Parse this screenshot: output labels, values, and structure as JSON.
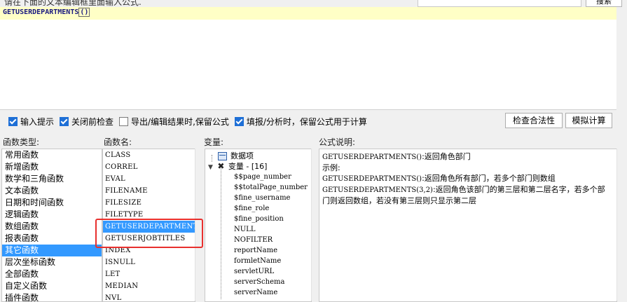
{
  "top": {
    "hint": "请在下面的文本编辑框里面输入公式.",
    "search_button": "搜索"
  },
  "editor": {
    "formula_name": "GETUSERDEPARTMENTS",
    "open_paren": "(",
    "close_paren": ")"
  },
  "options": {
    "input_hint": "输入提示",
    "check_before_close": "关闭前检查",
    "export_keep_formula": "导出/编辑结果时,保留公式",
    "fill_keep_formula": "填报/分析时，保留公式用于计算",
    "check_validity": "检查合法性",
    "simulate": "模拟计算"
  },
  "labels": {
    "func_type": "函数类型:",
    "func_name": "函数名:",
    "variable": "变量:",
    "formula_desc": "公式说明:"
  },
  "func_types": [
    {
      "label": "常用函数",
      "selected": false
    },
    {
      "label": "新增函数",
      "selected": false
    },
    {
      "label": "数学和三角函数",
      "selected": false
    },
    {
      "label": "文本函数",
      "selected": false
    },
    {
      "label": "日期和时间函数",
      "selected": false
    },
    {
      "label": "逻辑函数",
      "selected": false
    },
    {
      "label": "数组函数",
      "selected": false
    },
    {
      "label": "报表函数",
      "selected": false
    },
    {
      "label": "其它函数",
      "selected": true
    },
    {
      "label": "层次坐标函数",
      "selected": false
    },
    {
      "label": "全部函数",
      "selected": false
    },
    {
      "label": "自定义函数",
      "selected": false
    },
    {
      "label": "插件函数",
      "selected": false
    }
  ],
  "func_names": [
    {
      "label": "CLASS",
      "selected": false
    },
    {
      "label": "CORREL",
      "selected": false
    },
    {
      "label": "EVAL",
      "selected": false
    },
    {
      "label": "FILENAME",
      "selected": false
    },
    {
      "label": "FILESIZE",
      "selected": false
    },
    {
      "label": "FILETYPE",
      "selected": false
    },
    {
      "label": "GETUSERDEPARTMENTS",
      "selected": true
    },
    {
      "label": "GETUSERJOBTITLES",
      "selected": false
    },
    {
      "label": "INDEX",
      "selected": false
    },
    {
      "label": "ISNULL",
      "selected": false
    },
    {
      "label": "LET",
      "selected": false
    },
    {
      "label": "MEDIAN",
      "selected": false
    },
    {
      "label": "NVL",
      "selected": false
    }
  ],
  "tree": {
    "data_item": "数据项",
    "variables_node": "变量 - [16]",
    "variables": [
      "$$page_number",
      "$$totalPage_number",
      "$fine_username",
      "$fine_role",
      "$fine_position",
      "NULL",
      "NOFILTER",
      "reportName",
      "formletName",
      "servletURL",
      "serverSchema",
      "serverName"
    ]
  },
  "description": {
    "line1_code": "GETUSERDEPARTMENTS()",
    "line1_text": ":返回角色部门",
    "line2": "示例:",
    "line3_code": "GETUSERDEPARTMENTS()",
    "line3_text": ":返回角色所有部门，若多个部门则数组",
    "line4_code": "GETUSERDEPARTMENTS(3,2)",
    "line4_text": ":返回角色该部门的第三层和第二层名字，若多个部",
    "line5": "门则返回数组，若没有第三层则只显示第二层"
  }
}
